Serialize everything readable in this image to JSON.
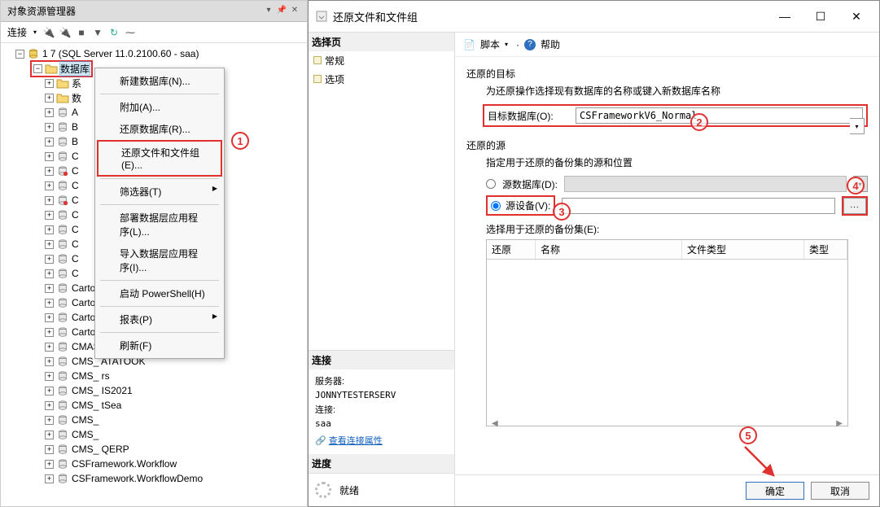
{
  "explorer": {
    "title": "对象资源管理器",
    "connect_label": "连接",
    "server_label": "7 (SQL Server 11.0.2100.60 - saa)",
    "selected_node": "数据库",
    "partial_rows": [
      "系",
      "数",
      "A",
      "B",
      "B",
      "C",
      "C",
      "C",
      "C",
      "C",
      "C",
      "C",
      "C",
      "C"
    ],
    "databases": [
      "CartonERP_System",
      "CartonERP_                 _Normal",
      "CartonERP_        _Normal",
      "CartonERP_       e_System",
      "CMAS_V  /I1",
      "CMS_    ATATOOK",
      "CMS_    rs",
      "CMS_     IS2021",
      "CMS_     tSea",
      "CMS_",
      "CMS_",
      "CMS_   QERP",
      "CSFramework.Workflow",
      "CSFramework.WorkflowDemo"
    ]
  },
  "context_menu": {
    "items": [
      "新建数据库(N)...",
      "附加(A)...",
      "还原数据库(R)...",
      "还原文件和文件组(E)...",
      "筛选器(T)",
      "部署数据层应用程序(L)...",
      "导入数据层应用程序(I)...",
      "启动 PowerShell(H)",
      "报表(P)",
      "刷新(F)"
    ]
  },
  "dialog": {
    "title": "还原文件和文件组",
    "pages_header": "选择页",
    "pages": [
      "常规",
      "选项"
    ],
    "script_label": "脚本",
    "help_label": "帮助",
    "target_section": "还原的目标",
    "target_desc": "为还原操作选择现有数据库的名称或键入新数据库名称",
    "target_db_label": "目标数据库(O):",
    "target_db_value": "CSFrameworkV6_Normal",
    "source_section": "还原的源",
    "source_desc": "指定用于还原的备份集的源和位置",
    "source_db_radio": "源数据库(D):",
    "source_dev_radio": "源设备(V):",
    "browse_label": "...",
    "select_sets": "选择用于还原的备份集(E):",
    "table_cols": [
      "还原",
      "名称",
      "文件类型",
      "类型"
    ],
    "conn_header": "连接",
    "server_label": "服务器:",
    "server_value": "JONNYTESTERSERV",
    "conn_label": "连接:",
    "conn_value": "saa",
    "view_conn": "查看连接属性",
    "progress_header": "进度",
    "progress_status": "就绪",
    "ok_label": "确定",
    "cancel_label": "取消"
  },
  "annotations": {
    "c1": "1",
    "c2": "2",
    "c3": "3",
    "c4": "4",
    "c5": "5"
  }
}
